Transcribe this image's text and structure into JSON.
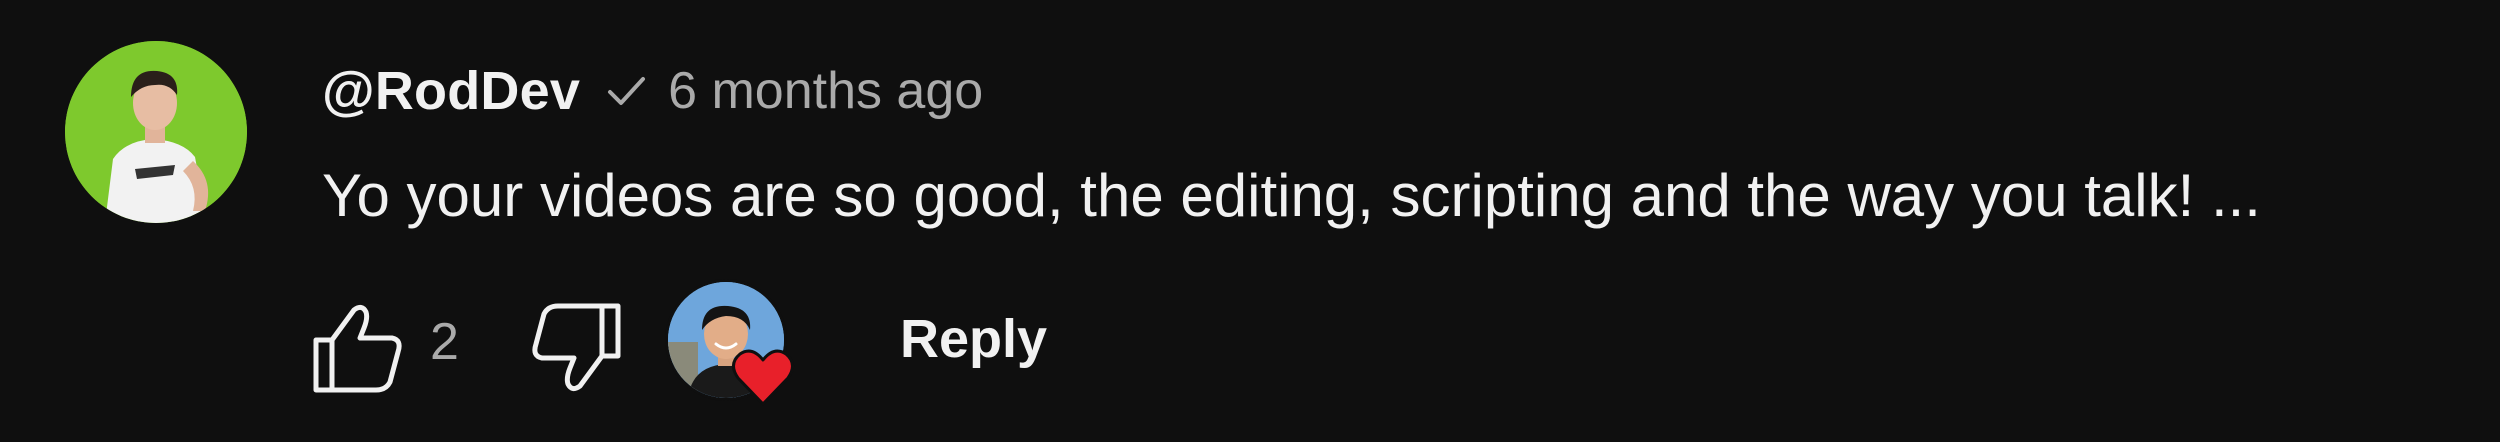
{
  "comment": {
    "author": "@RodDev",
    "verified": true,
    "timestamp": "6 months ago",
    "text": "Yo your videos are so good, the editing, scripting and the way you talk! ...",
    "like_count": "2",
    "reply_label": "Reply",
    "creator_hearted": true
  },
  "colors": {
    "background": "#0f0f0f",
    "primary_text": "#f1f1f1",
    "secondary_text": "#aaaaaa",
    "heart": "#e8202a",
    "author_avatar_bg": "#7ec92d"
  },
  "icons": {
    "verified": "checkmark-icon",
    "like": "thumbs-up-icon",
    "dislike": "thumbs-down-icon",
    "heart": "heart-icon"
  }
}
